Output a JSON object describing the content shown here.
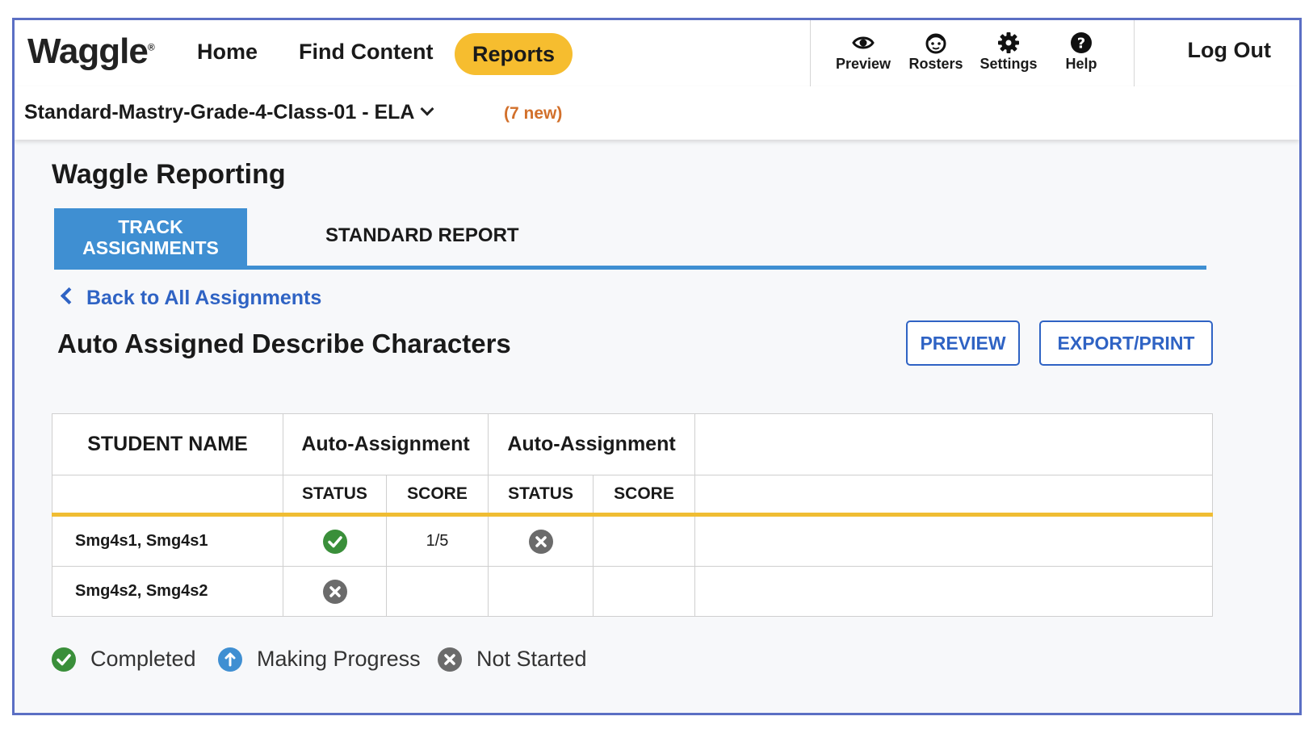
{
  "nav": {
    "logo": "Waggle",
    "logo_mark": "®",
    "home": "Home",
    "find_content": "Find Content",
    "reports": "Reports",
    "tools": [
      {
        "label": "Preview",
        "icon": "eye-icon"
      },
      {
        "label": "Rosters",
        "icon": "face-icon"
      },
      {
        "label": "Settings",
        "icon": "gear-icon"
      },
      {
        "label": "Help",
        "icon": "help-icon"
      }
    ],
    "logout": "Log Out",
    "accent": "#f6bd2f"
  },
  "class_bar": {
    "selected_class": "Standard-Mastry-Grade-4-Class-01 - ELA",
    "new_count": "(7 new)"
  },
  "page": {
    "title": "Waggle Reporting",
    "tabs": [
      {
        "label": "TRACK ASSIGNMENTS",
        "active": true
      },
      {
        "label": "STANDARD REPORT",
        "active": false
      }
    ],
    "back_link": "Back to All Assignments",
    "assignment_title": "Auto Assigned Describe Characters",
    "preview_button": "PREVIEW",
    "export_button": "EXPORT/PRINT"
  },
  "table": {
    "student_header": "STUDENT NAME",
    "groups": [
      "Auto-Assignment",
      "Auto-Assignment"
    ],
    "sub_headers": [
      "STATUS",
      "SCORE",
      "STATUS",
      "SCORE"
    ],
    "rows": [
      {
        "name": "Smg4s1, Smg4s1",
        "cells": [
          {
            "status": "completed"
          },
          {
            "score": "1/5"
          },
          {
            "status": "not-started"
          },
          {
            "score": ""
          }
        ]
      },
      {
        "name": "Smg4s2, Smg4s2",
        "cells": [
          {
            "status": "not-started"
          },
          {
            "score": ""
          },
          {
            "status": ""
          },
          {
            "score": ""
          }
        ]
      }
    ]
  },
  "legend": [
    {
      "label": "Completed",
      "icon": "check-circle-icon",
      "color": "#3a8f3a"
    },
    {
      "label": "Making Progress",
      "icon": "arrow-up-circle-icon",
      "color": "#3f8fd2"
    },
    {
      "label": "Not Started",
      "icon": "x-circle-icon",
      "color": "#6b6b6b"
    }
  ]
}
